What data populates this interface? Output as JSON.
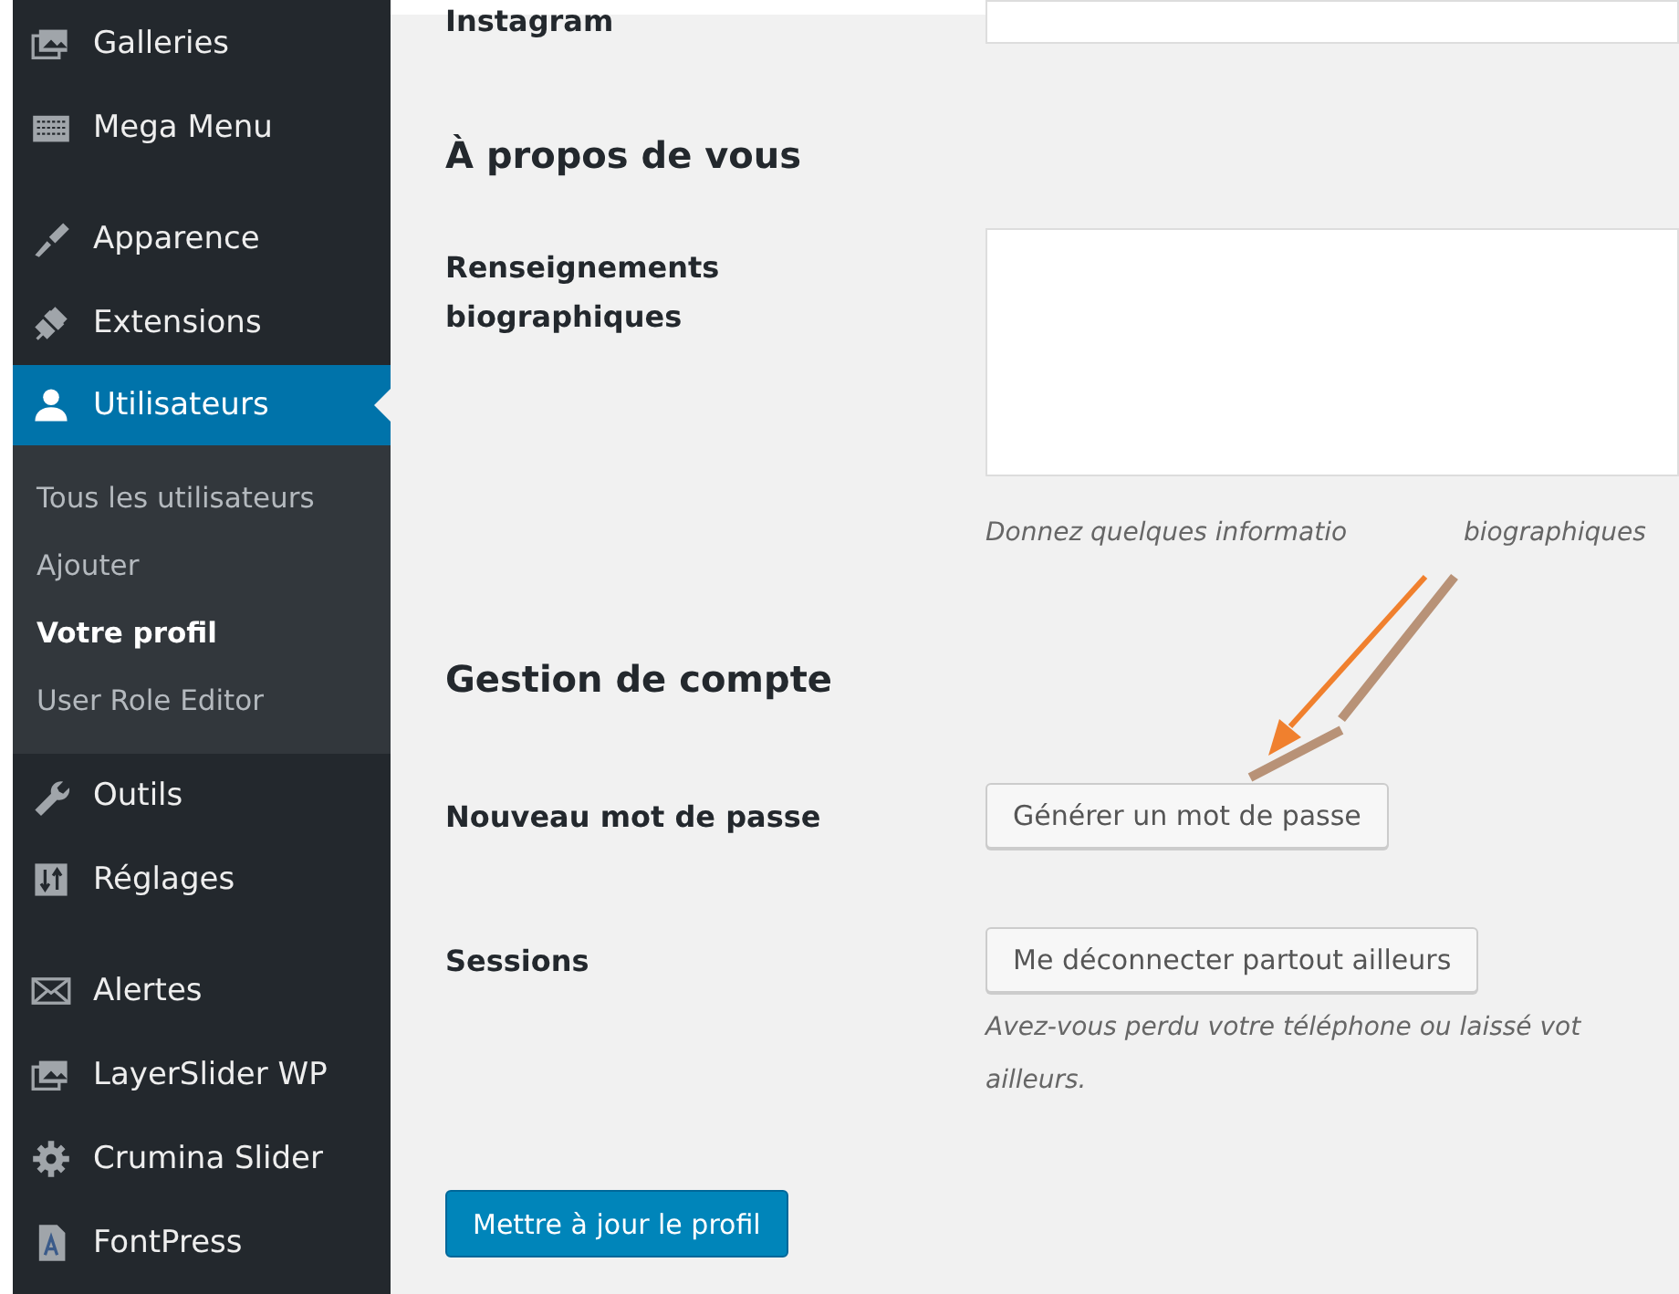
{
  "sidebar": {
    "groups": [
      [
        {
          "label": "Galleries",
          "selected": false
        },
        {
          "label": "Mega Menu",
          "selected": false
        }
      ],
      [
        {
          "label": "Apparence",
          "selected": false
        },
        {
          "label": "Extensions",
          "selected": false
        },
        {
          "label": "Utilisateurs",
          "selected": true,
          "children": [
            {
              "label": "Tous les utilisateurs",
              "selected": false
            },
            {
              "label": "Ajouter",
              "selected": false
            },
            {
              "label": "Votre profil",
              "selected": true
            },
            {
              "label": "User Role Editor",
              "selected": false
            }
          ]
        },
        {
          "label": "Outils",
          "selected": false
        },
        {
          "label": "Réglages",
          "selected": false
        }
      ],
      [
        {
          "label": "Alertes",
          "selected": false
        },
        {
          "label": "LayerSlider WP",
          "selected": false
        },
        {
          "label": "Crumina Slider",
          "selected": false
        },
        {
          "label": "FontPress",
          "selected": false
        }
      ]
    ]
  },
  "form": {
    "instagram_label": "Instagram",
    "about_heading": "À propos de vous",
    "bio": {
      "label": "Renseignements biographiques",
      "hint": [
        "Donnez quelques informatio",
        "biographiques"
      ]
    },
    "account_heading": "Gestion de compte",
    "password": {
      "label": "Nouveau mot de passe",
      "button": "Générer un mot de passe"
    },
    "sessions": {
      "label": "Sessions",
      "button": "Me déconnecter partout ailleurs",
      "hint_lines": [
        "Avez-vous perdu votre téléphone ou laissé vot",
        "ailleurs."
      ]
    },
    "submit": "Mettre à jour le profil"
  }
}
